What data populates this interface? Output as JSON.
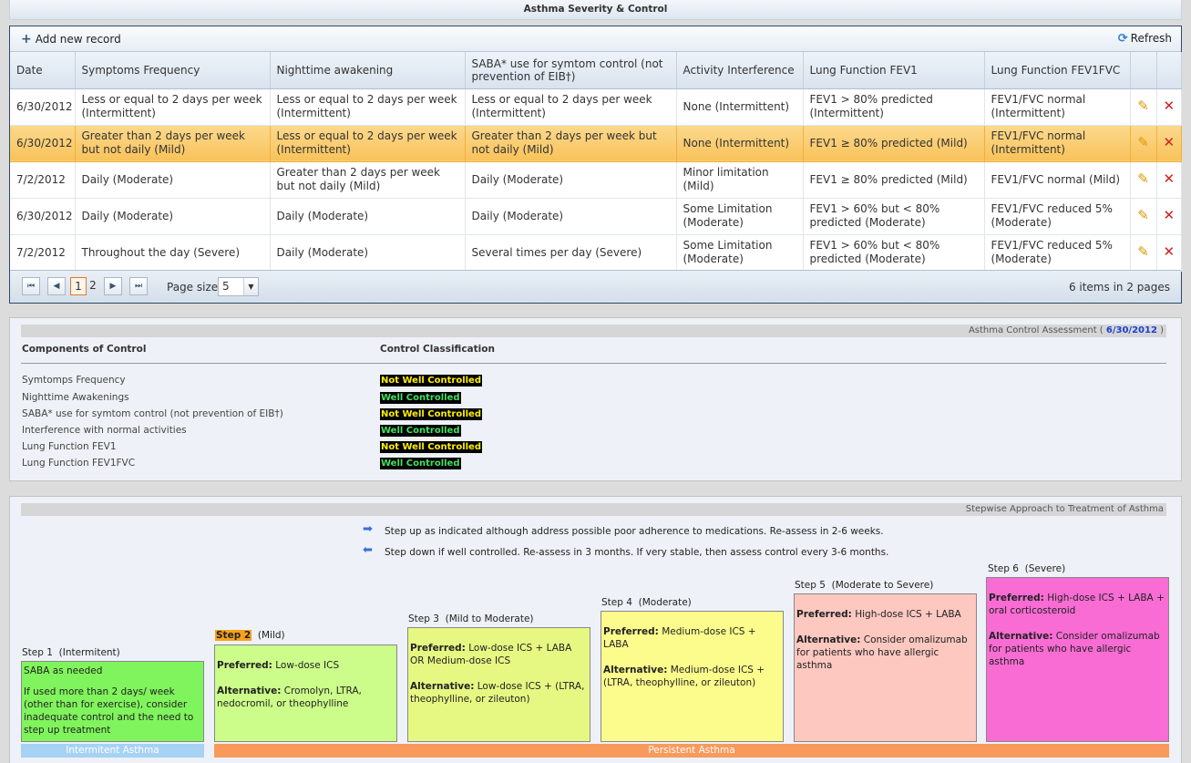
{
  "header": {
    "title": "Asthma Severity & Control"
  },
  "toolbar": {
    "add_label": "Add new record",
    "refresh_label": "Refresh"
  },
  "grid": {
    "columns": [
      "Date",
      "Symptoms Frequency",
      "Nighttime awakening",
      "SABA* use for symtom control (not prevention of EIB†)",
      "Activity Interference",
      "Lung Function FEV1",
      "Lung Function FEV1FVC"
    ],
    "rows": [
      [
        "6/30/2012",
        "Less or equal to 2 days per week (Intermittent)",
        "Less or equal to 2 days per week (Intermittent)",
        "Less or equal to 2 days per week (Intermittent)",
        "None (Intermittent)",
        "FEV1 > 80% predicted (Intermittent)",
        "FEV1/FVC normal (Intermittent)"
      ],
      [
        "6/30/2012",
        "Greater than 2 days per week but not daily (Mild)",
        "Less or equal to 2 days per week (Intermittent)",
        "Greater than 2 days per week but not daily (Mild)",
        "None (Intermittent)",
        "FEV1 ≥ 80% predicted (Mild)",
        "FEV1/FVC normal (Intermittent)"
      ],
      [
        "7/2/2012",
        "Daily (Moderate)",
        "Greater than 2 days per week but not daily (Mild)",
        "Daily (Moderate)",
        "Minor limitation (Mild)",
        "FEV1 ≥ 80% predicted (Mild)",
        "FEV1/FVC normal (Mild)"
      ],
      [
        "6/30/2012",
        "Daily (Moderate)",
        "Daily (Moderate)",
        "Daily (Moderate)",
        "Some Limitation (Moderate)",
        "FEV1 > 60% but < 80% predicted (Moderate)",
        "FEV1/FVC reduced 5% (Moderate)"
      ],
      [
        "7/2/2012",
        "Throughout the day (Severe)",
        "Daily (Moderate)",
        "Several times per day (Severe)",
        "Some Limitation (Moderate)",
        "FEV1 > 60% but < 80% predicted (Moderate)",
        "FEV1/FVC reduced 5% (Moderate)"
      ]
    ],
    "selected_row": 1,
    "row_actions": {
      "edit_icon": "pencil-icon",
      "delete_icon": "delete-x-icon"
    }
  },
  "pager": {
    "first": "⏮",
    "prev": "◀",
    "next": "▶",
    "last": "⏭",
    "pages": [
      "1",
      "2"
    ],
    "current_page": "1",
    "page_size_label": "Page size:",
    "page_size": "5",
    "info": "6 items in 2 pages"
  },
  "control": {
    "title_prefix": "Asthma Control Assessment (",
    "date": "6/30/2012",
    "title_suffix": ")",
    "col1": "Components of Control",
    "col2": "Control Classification",
    "rows": [
      {
        "label": "Symtomps Frequency",
        "value": "Not Well Controlled",
        "status": "bad"
      },
      {
        "label": "Nighttime Awakenings",
        "value": "Well Controlled",
        "status": "good"
      },
      {
        "label": "SABA* use for symtom control (not prevention of EIB†)",
        "value": "Not Well Controlled",
        "status": "bad"
      },
      {
        "label": "Interference with normal activities",
        "value": "Well Controlled",
        "status": "good"
      },
      {
        "label": "Lung Function FEV1",
        "value": "Not Well Controlled",
        "status": "bad"
      },
      {
        "label": "Lung Function FEV1FVC",
        "value": "Well Controlled",
        "status": "good"
      }
    ],
    "colors": {
      "bad": "#ffef00",
      "good": "#44e062"
    }
  },
  "stepwise": {
    "title": "Stepwise Approach to Treatment of Asthma",
    "step_up": "Step up as indicated although address possible poor adherence to medications. Re-assess in 2-6 weeks.",
    "step_down": "Step down if well controlled. Re-assess in 3 months. If very stable, then assess control every 3-6 months.",
    "steps": [
      {
        "name": "Step 1",
        "level": "(Intermitent)",
        "text1": "SABA as needed",
        "text2": "If used more than 2 days/ week (other than for exercise), consider inadequate control and the need to step up treatment",
        "color": "#80f45c"
      },
      {
        "name": "Step 2",
        "level": "(Mild)",
        "pref_label": "Preferred:",
        "pref": "Low-dose ICS",
        "alt_label": "Alternative:",
        "alt": "Cromolyn, LTRA, nedocromil, or theophylline",
        "color": "#ccfc8a"
      },
      {
        "name": "Step 3",
        "level": "(Mild to Moderate)",
        "pref_label": "Preferred:",
        "pref": "Low-dose ICS + LABA OR Medium-dose ICS",
        "alt_label": "Alternative:",
        "alt": "Low-dose ICS + (LTRA, theophylline, or zileuton)",
        "color": "#e7f882"
      },
      {
        "name": "Step 4",
        "level": "(Moderate)",
        "pref_label": "Preferred:",
        "pref": "Medium-dose ICS + LABA",
        "alt_label": "Alternative:",
        "alt": "Medium-dose ICS + (LTRA, theophylline, or zileuton)",
        "color": "#fcfc8c"
      },
      {
        "name": "Step 5",
        "level": "(Moderate to Severe)",
        "pref_label": "Preferred:",
        "pref": "High-dose ICS + LABA",
        "alt_label": "Alternative:",
        "alt": "Consider omalizumab for patients who have allergic asthma",
        "color": "#fcc8c0"
      },
      {
        "name": "Step 6",
        "level": "(Severe)",
        "pref_label": "Preferred:",
        "pref": "High-dose ICS + LABA + oral corticosteroid",
        "alt_label": "Alternative:",
        "alt": "Consider omalizumab for patients who have allergic asthma",
        "color": "#f86cd4"
      }
    ],
    "band_intermittent": "Intermitent Asthma",
    "band_persistent": "Persistent Asthma",
    "band_colors": {
      "intermittent": "#a6d2f4",
      "persistent": "#f89a5c"
    }
  }
}
